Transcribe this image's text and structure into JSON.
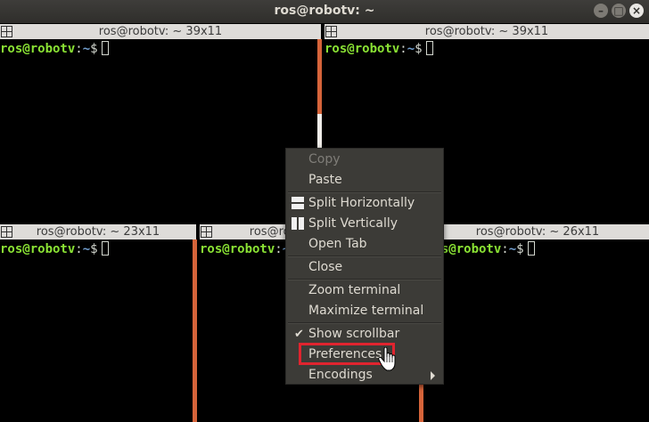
{
  "window": {
    "title": "ros@robotv: ~",
    "buttons": [
      "minimize",
      "maximize",
      "close"
    ]
  },
  "panes": [
    {
      "id": "top-left",
      "title": "ros@robotv: ~ 39x11",
      "prompt_user": "ros@robotv",
      "prompt_colon": ":",
      "prompt_path": "~",
      "prompt_dollar": "$"
    },
    {
      "id": "top-right",
      "title": "ros@robotv: ~ 39x11",
      "prompt_user": "ros@robotv",
      "prompt_colon": ":",
      "prompt_path": "~",
      "prompt_dollar": "$"
    },
    {
      "id": "bottom-left",
      "title": "ros@robotv: ~ 23x11",
      "prompt_user": "ros@robotv",
      "prompt_colon": ":",
      "prompt_path": "~",
      "prompt_dollar": "$"
    },
    {
      "id": "bottom-middle",
      "title": "ros@robotv: ~ 23x11",
      "prompt_user": "ros@robotv",
      "prompt_colon": ":",
      "prompt_path": "~",
      "prompt_dollar": "$"
    },
    {
      "id": "bottom-right",
      "title": "ros@robotv: ~ 26x11",
      "prompt_user": "ros@robotv",
      "prompt_colon": ":",
      "prompt_path": "~",
      "prompt_dollar": "$"
    }
  ],
  "context_menu": {
    "items": [
      {
        "label": "Copy",
        "enabled": false
      },
      {
        "label": "Paste",
        "enabled": true
      },
      {
        "label": "Split Horizontally",
        "icon": "split-horizontal-icon"
      },
      {
        "label": "Split Vertically",
        "icon": "split-vertical-icon"
      },
      {
        "label": "Open Tab"
      },
      {
        "label": "Close"
      },
      {
        "label": "Zoom terminal"
      },
      {
        "label": "Maximize terminal"
      },
      {
        "label": "Show scrollbar",
        "checked": true,
        "check_mark": "✔"
      },
      {
        "label": "Preferences",
        "highlighted": true
      },
      {
        "label": "Encodings",
        "has_submenu": true
      }
    ]
  },
  "colors": {
    "scrollbar": "#d6643a",
    "highlight_box": "#e0242f",
    "prompt_user": "#8ae234",
    "prompt_path": "#729fcf",
    "menu_bg": "#3c3b37"
  }
}
